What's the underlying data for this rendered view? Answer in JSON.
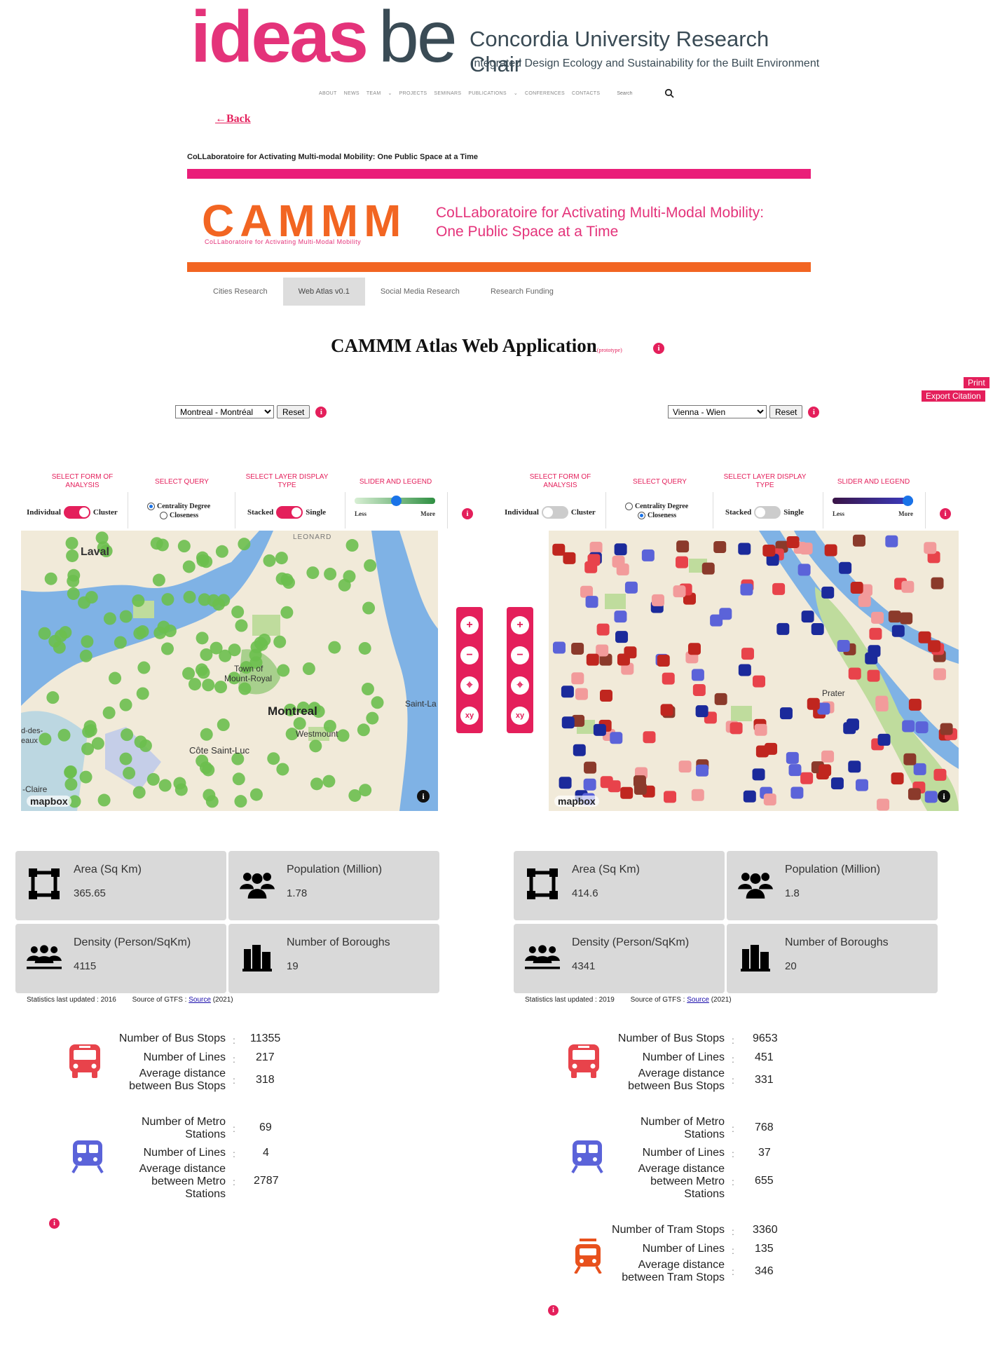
{
  "header": {
    "logo_ideas": "ideas",
    "logo_be": "be",
    "logo_title": "Concordia University Research Chair",
    "logo_subtitle": "Integrated Design Ecology and Sustainability for the Built Environment",
    "nav": [
      "ABOUT",
      "NEWS",
      "TEAM",
      "PROJECTS",
      "SEMINARS",
      "PUBLICATIONS",
      "CONFERENCES",
      "CONTACTS"
    ],
    "search_placeholder": "Search"
  },
  "back_label": "←Back",
  "project_heading": "CoLLaboratoire for Activating Multi-modal Mobility: One Public Space at a Time",
  "banner": {
    "logo": "CAMMM",
    "logo_sub": "CoLLaboratoire for Activating Multi-Modal Mobility",
    "title_line1": "CoLLaboratoire for Activating Multi-Modal Mobility:",
    "title_line2": "One Public Space at a Time"
  },
  "tabs": [
    {
      "label": "Cities Research",
      "active": false
    },
    {
      "label": "Web Atlas v0.1",
      "active": true
    },
    {
      "label": "Social Media Research",
      "active": false
    },
    {
      "label": "Research Funding",
      "active": false
    }
  ],
  "app_title": "CAMMM Atlas Web Application",
  "app_title_tag": "(prototype)",
  "print_label": "Print",
  "export_label": "Export Citation",
  "reset_label": "Reset",
  "controls": {
    "form_heading": "SELECT FORM OF ANALYSIS",
    "query_heading": "SELECT QUERY",
    "layer_heading": "SELECT LAYER DISPLAY TYPE",
    "slider_heading": "SLIDER AND LEGEND",
    "individual": "Individual",
    "cluster": "Cluster",
    "centrality": "Centrality Degree",
    "closeness": "Closeness",
    "stacked": "Stacked",
    "single": "Single",
    "less": "Less",
    "more": "More"
  },
  "left": {
    "city": "Montreal - Montréal",
    "cluster_on": true,
    "query": "Centrality Degree",
    "single_on": true,
    "slider_level": 0.52,
    "map_labels": [
      "Laval",
      "Town of",
      "Mount-Royal",
      "Montreal",
      "Westmount",
      "Côte Saint-Luc",
      "Saint-La",
      "LEONARD",
      "-Claire",
      "d-des-",
      "eaux"
    ],
    "stats": {
      "area_label": "Area (Sq Km)",
      "area": "365.65",
      "pop_label": "Population (Million)",
      "pop": "1.78",
      "density_label": "Density (Person/SqKm)",
      "density": "4115",
      "boroughs_label": "Number of Boroughs",
      "boroughs": "19"
    },
    "updated": "Statistics last updated : 2016",
    "gtfs_prefix": "Source of GTFS :",
    "gtfs_link": "Source",
    "gtfs_year": "(2021)",
    "bus": {
      "stops_label": "Number of Bus Stops",
      "stops": "11355",
      "lines_label": "Number of Lines",
      "lines": "217",
      "dist_label_1": "Average distance",
      "dist_label_2": "between Bus Stops",
      "dist": "318"
    },
    "metro": {
      "stations_label_1": "Number of Metro",
      "stations_label_2": "Stations",
      "stations": "69",
      "lines_label": "Number of Lines",
      "lines": "4",
      "dist_label_1": "Average distance",
      "dist_label_2": "between Metro",
      "dist_label_3": "Stations",
      "dist": "2787"
    }
  },
  "right": {
    "city": "Vienna - Wien",
    "cluster_on": false,
    "query": "Closeness",
    "single_on": false,
    "slider_level": 1.0,
    "map_labels": [
      "Prater"
    ],
    "stats": {
      "area_label": "Area (Sq Km)",
      "area": "414.6",
      "pop_label": "Population (Million)",
      "pop": "1.8",
      "density_label": "Density (Person/SqKm)",
      "density": "4341",
      "boroughs_label": "Number of Boroughs",
      "boroughs": "20"
    },
    "updated": "Statistics last updated : 2019",
    "gtfs_prefix": "Source of GTFS :",
    "gtfs_link": "Source",
    "gtfs_year": "(2021)",
    "bus": {
      "stops_label": "Number of Bus Stops",
      "stops": "9653",
      "lines_label": "Number of Lines",
      "lines": "451",
      "dist_label_1": "Average distance",
      "dist_label_2": "between Bus Stops",
      "dist": "331"
    },
    "metro": {
      "stations_label_1": "Number of Metro",
      "stations_label_2": "Stations",
      "stations": "768",
      "lines_label": "Number of Lines",
      "lines": "37",
      "dist_label_1": "Average distance",
      "dist_label_2": "between Metro",
      "dist_label_3": "Stations",
      "dist": "655"
    },
    "tram": {
      "stops_label": "Number of Tram Stops",
      "stops": "3360",
      "lines_label": "Number of Lines",
      "lines": "135",
      "dist_label_1": "Average distance",
      "dist_label_2": "between Tram Stops",
      "dist": "346"
    }
  },
  "map_attribution": "mapbox",
  "colors": {
    "accent": "#e41f5b",
    "bus": "#e8434b",
    "metro": "#5b63d9",
    "tram": "#e8511d",
    "green_marker": "#6cbf4e"
  }
}
